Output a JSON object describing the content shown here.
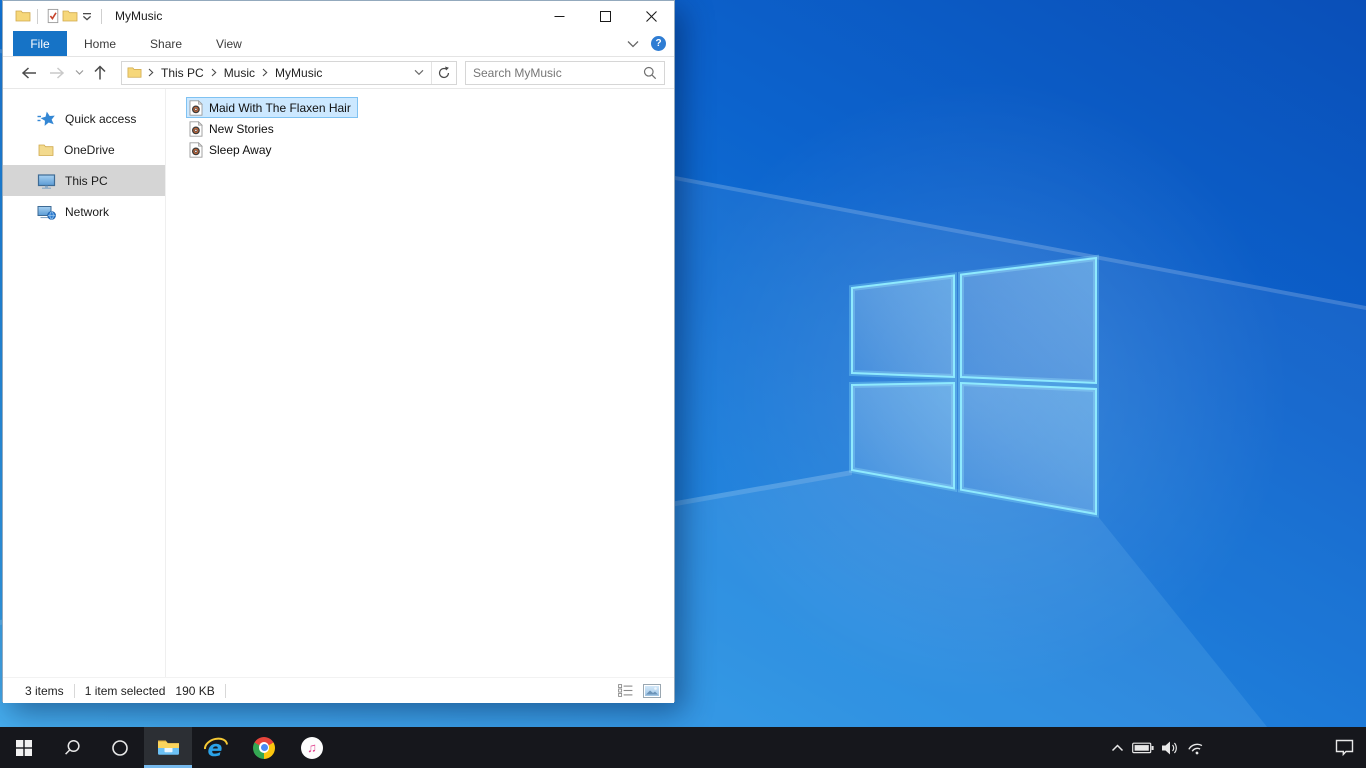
{
  "colors": {
    "accent_blue": "#1673c6",
    "selection_bg": "#cce8ff",
    "selection_border": "#7fc2f2",
    "sidebar_selected_bg": "#d5d5d5",
    "taskbar_bg": "#16171c",
    "taskbar_active_underline": "#76b9ed",
    "wallpaper_light": "#2fa3ec",
    "wallpaper_dark": "#0a4fb8"
  },
  "window": {
    "title": "MyMusic",
    "quick_access_toolbar": {
      "icons": [
        "explorer-folder-icon",
        "properties-check-icon",
        "new-folder-icon",
        "customize-qat-dropdown-icon"
      ]
    },
    "caption_buttons": [
      "minimize",
      "maximize",
      "close"
    ],
    "ribbon_tabs": [
      {
        "label": "File",
        "active": true
      },
      {
        "label": "Home",
        "active": false
      },
      {
        "label": "Share",
        "active": false
      },
      {
        "label": "View",
        "active": false
      }
    ],
    "ribbon_right": {
      "expand_icon": "chevron-down-icon",
      "help_label": "?"
    },
    "navigation": {
      "back_enabled": true,
      "forward_enabled": false,
      "breadcrumb": [
        "This PC",
        "Music",
        "MyMusic"
      ],
      "address_icons": [
        "folder-icon",
        "history-chevron-icon",
        "refresh-icon"
      ],
      "search_placeholder": "Search MyMusic",
      "search_icon": "magnifier-icon"
    },
    "sidebar": {
      "items": [
        {
          "label": "Quick access",
          "icon": "quick-access-star-icon",
          "selected": false
        },
        {
          "label": "OneDrive",
          "icon": "folder-icon",
          "selected": false
        },
        {
          "label": "This PC",
          "icon": "monitor-icon",
          "selected": true
        },
        {
          "label": "Network",
          "icon": "network-icon",
          "selected": false
        }
      ]
    },
    "files": [
      {
        "name": "Maid With The Flaxen Hair",
        "icon": "music-file-icon",
        "selected": true
      },
      {
        "name": "New Stories",
        "icon": "music-file-icon",
        "selected": false
      },
      {
        "name": "Sleep Away",
        "icon": "music-file-icon",
        "selected": false
      }
    ],
    "status_bar": {
      "item_count": "3 items",
      "selection": "1 item selected",
      "selection_size": "190 KB",
      "view_buttons": [
        "details-view-icon",
        "large-icons-view-icon"
      ]
    }
  },
  "taskbar": {
    "buttons": [
      {
        "name": "start",
        "active": false
      },
      {
        "name": "search",
        "active": false
      },
      {
        "name": "cortana",
        "active": false
      },
      {
        "name": "file-explorer",
        "active": true
      },
      {
        "name": "internet-explorer",
        "active": false
      },
      {
        "name": "chrome",
        "active": false
      },
      {
        "name": "itunes",
        "active": false
      }
    ],
    "itunes_note_glyph": "♫",
    "tray_icons": [
      "hidden-icons-chevron",
      "battery",
      "volume",
      "wifi"
    ],
    "action_center_icon": "action-center"
  }
}
